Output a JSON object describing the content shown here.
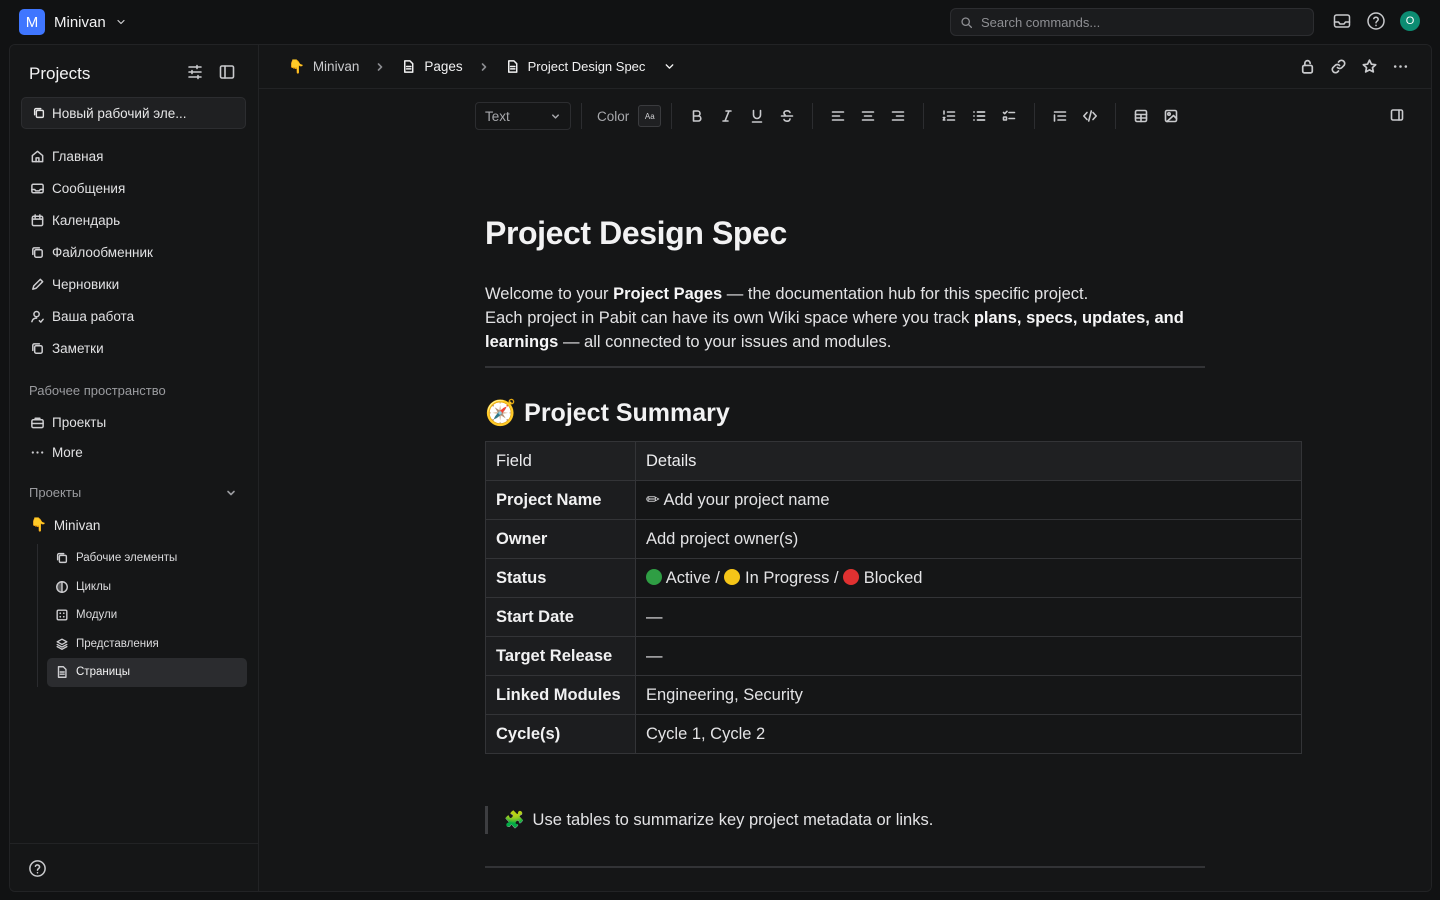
{
  "workspace": {
    "initial": "M",
    "name": "Minivan"
  },
  "search": {
    "placeholder": "Search commands..."
  },
  "user": {
    "initial": "O"
  },
  "sidebar": {
    "title": "Projects",
    "new_item": "Новый рабочий эле...",
    "items": [
      {
        "label": "Главная",
        "icon": "home-icon"
      },
      {
        "label": "Сообщения",
        "icon": "inbox-icon"
      },
      {
        "label": "Календарь",
        "icon": "calendar-icon"
      },
      {
        "label": "Файлообменник",
        "icon": "stack-icon"
      },
      {
        "label": "Черновики",
        "icon": "pen-icon"
      },
      {
        "label": "Ваша работа",
        "icon": "user-icon"
      },
      {
        "label": "Заметки",
        "icon": "notes-icon"
      }
    ],
    "workspace_section": "Рабочее пространство",
    "workspace_items": [
      {
        "label": "Проекты",
        "icon": "briefcase-icon"
      },
      {
        "label": "More",
        "icon": "more-icon"
      }
    ],
    "projects_section": "Проекты",
    "project": {
      "emoji": "👇",
      "name": "Minivan"
    },
    "project_items": [
      {
        "label": "Рабочие элементы",
        "icon": "layers-icon"
      },
      {
        "label": "Циклы",
        "icon": "cycle-icon"
      },
      {
        "label": "Модули",
        "icon": "module-icon"
      },
      {
        "label": "Представления",
        "icon": "views-icon"
      },
      {
        "label": "Страницы",
        "icon": "page-icon",
        "active": true
      }
    ]
  },
  "breadcrumb": {
    "project": "Minivan",
    "project_emoji": "👇",
    "pages": "Pages",
    "page": "Project Design Spec"
  },
  "toolbar": {
    "text_style": "Text",
    "color_label": "Color",
    "aa": "Aa"
  },
  "doc": {
    "title": "Project Design Spec",
    "intro": {
      "p1_a": "Welcome to your ",
      "p1_b": "Project Pages",
      "p1_c": " — the documentation hub for this specific project.",
      "p2_a": "Each project in Pabit can have its own Wiki space where you track ",
      "p2_b": "plans, specs, updates, and learnings",
      "p2_c": " — all connected to your issues and modules."
    },
    "summary_heading": "Project Summary",
    "summary_emoji": "🧭",
    "table": {
      "headers": [
        "Field",
        "Details"
      ],
      "rows": [
        {
          "field": "Project Name",
          "detail": "✏ Add your project name"
        },
        {
          "field": "Owner",
          "detail": "Add project owner(s)"
        },
        {
          "field": "Status",
          "detail": ""
        },
        {
          "field": "Start Date",
          "detail": "—"
        },
        {
          "field": "Target Release",
          "detail": "—"
        },
        {
          "field": "Linked Modules",
          "detail": "Engineering, Security"
        },
        {
          "field": "Cycle(s)",
          "detail": "Cycle 1, Cycle 2"
        }
      ],
      "status": {
        "active": "Active /",
        "progress": "In Progress /",
        "blocked": "Blocked",
        "colors": {
          "active": "#2f9e44",
          "progress": "#f5c518",
          "blocked": "#e03131"
        }
      }
    },
    "quote_emoji": "🧩",
    "quote": "Use tables to summarize key project metadata or links."
  },
  "colors": {
    "accent": "#3f76ff",
    "user": "#0c8c72",
    "background": "#151617"
  }
}
